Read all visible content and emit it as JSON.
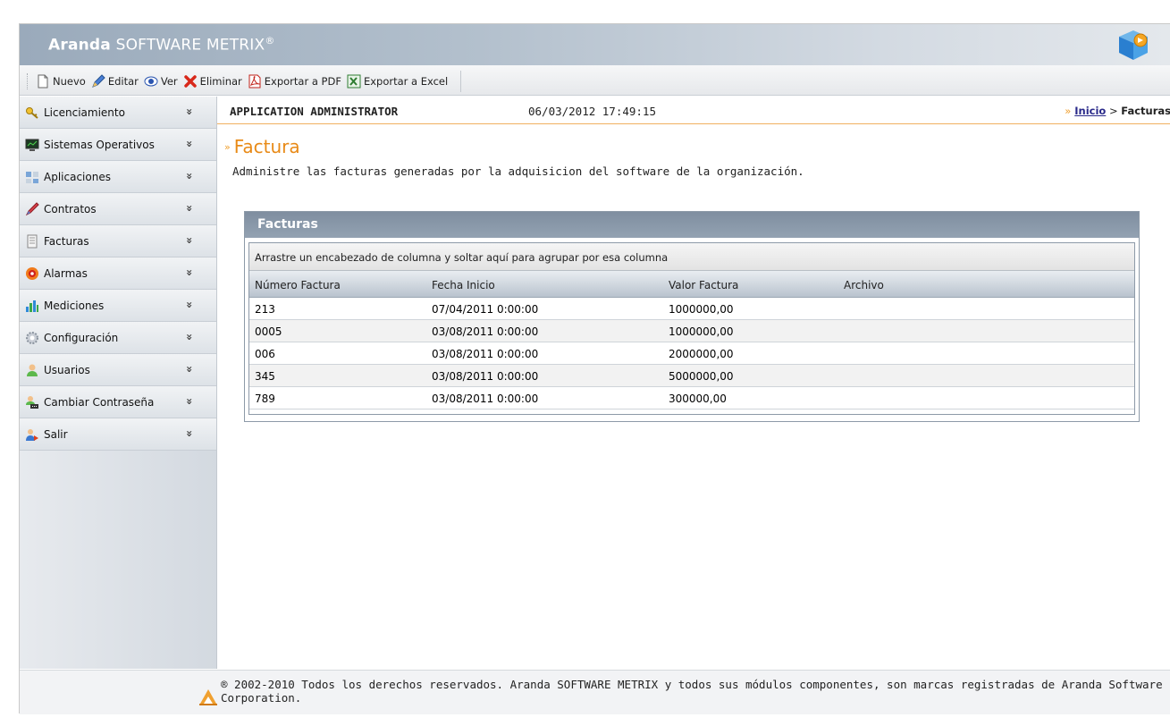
{
  "header": {
    "brand_bold": "Aranda",
    "brand_light": "SOFTWARE METRIX",
    "brand_reg": "®"
  },
  "toolbar": {
    "new_label": "Nuevo",
    "edit_label": "Editar",
    "view_label": "Ver",
    "delete_label": "Eliminar",
    "pdf_label": "Exportar a PDF",
    "excel_label": "Exportar a Excel"
  },
  "sidebar": {
    "items": [
      {
        "label": "Licenciamiento",
        "icon": "key-icon"
      },
      {
        "label": "Sistemas Operativos",
        "icon": "monitor-icon"
      },
      {
        "label": "Aplicaciones",
        "icon": "applications-icon"
      },
      {
        "label": "Contratos",
        "icon": "pen-icon"
      },
      {
        "label": "Facturas",
        "icon": "document-icon"
      },
      {
        "label": "Alarmas",
        "icon": "alarm-icon"
      },
      {
        "label": "Mediciones",
        "icon": "bar-chart-icon"
      },
      {
        "label": "Configuración",
        "icon": "gear-icon"
      },
      {
        "label": "Usuarios",
        "icon": "user-icon"
      },
      {
        "label": "Cambiar Contraseña",
        "icon": "user-password-icon"
      },
      {
        "label": "Salir",
        "icon": "exit-user-icon"
      }
    ],
    "chevron": "»"
  },
  "infobar": {
    "user": "APPLICATION ADMINISTRATOR",
    "datetime": "06/03/2012 17:49:15",
    "breadcrumb_home": "Inicio",
    "breadcrumb_sep": ">",
    "breadcrumb_current": "Facturas"
  },
  "page": {
    "title": "Factura",
    "description": "Administre las facturas generadas por la adquisicion del software de la organización."
  },
  "panel": {
    "title": "Facturas",
    "group_hint": "Arrastre un encabezado de columna y soltar aquí para agrupar por esa columna",
    "columns": [
      "Número Factura",
      "Fecha Inicio",
      "Valor Factura",
      "Archivo"
    ],
    "rows": [
      [
        "213",
        "07/04/2011 0:00:00",
        "1000000,00",
        ""
      ],
      [
        "0005",
        "03/08/2011 0:00:00",
        "1000000,00",
        ""
      ],
      [
        "006",
        "03/08/2011 0:00:00",
        "2000000,00",
        ""
      ],
      [
        "345",
        "03/08/2011 0:00:00",
        "5000000,00",
        ""
      ],
      [
        "789",
        "03/08/2011 0:00:00",
        "300000,00",
        ""
      ]
    ]
  },
  "footer": {
    "text": "® 2002-2010 Todos los derechos reservados. Aranda SOFTWARE METRIX y todos sus módulos componentes, son marcas registradas de Aranda Software Corporation."
  },
  "colors": {
    "accent_orange": "#e88a17",
    "header_blue": "#9aaabb",
    "panel_head": "#8796a8"
  }
}
